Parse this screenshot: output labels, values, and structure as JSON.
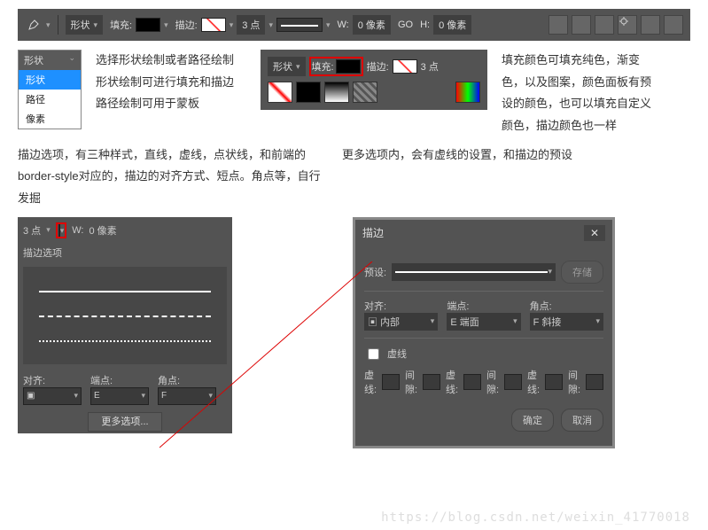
{
  "toolbar": {
    "shape_label": "形状",
    "fill_label": "填充:",
    "stroke_label": "描边:",
    "points": "3 点",
    "width_label": "W:",
    "width_val": "0 像素",
    "link_label": "GO",
    "height_label": "H:",
    "height_val": "0 像素"
  },
  "shape_dd": {
    "head": "形状",
    "items": [
      "形状",
      "路径",
      "像素"
    ]
  },
  "text": {
    "shape_desc_1": "选择形状绘制或者路径绘制",
    "shape_desc_2": "形状绘制可进行填充和描边",
    "shape_desc_3": "路径绘制可用于蒙板",
    "fill_desc": "填充颜色可填充纯色，渐变色，以及图案，颜色面板有预设的颜色，也可以填充自定义颜色，描边颜色也一样",
    "stroke_opts_desc": "描边选项，有三种样式，直线，虚线，点状线，和前端的border-style对应的，描边的对齐方式、短点。角点等，自行发掘",
    "more_opts_desc": "更多选项内，会有虚线的设置，和描边的预设"
  },
  "mini_toolbar": {
    "shape": "形状",
    "fill": "填充:",
    "stroke": "描边:",
    "pts": "3 点"
  },
  "stroke_panel": {
    "pts": "3 点",
    "w": "W:",
    "wval": "0 像素",
    "title": "描边选项",
    "align": "对齐:",
    "cap": "端点:",
    "corner": "角点:",
    "more": "更多选项..."
  },
  "dialog": {
    "title": "描边",
    "preset": "预设:",
    "save": "存储",
    "align": "对齐:",
    "align_val": "内部",
    "cap": "端点:",
    "cap_val": "端面",
    "corner": "角点:",
    "corner_val": "斜接",
    "dashed": "虚线",
    "dash_lbl": "虚线:",
    "gap_lbl": "间隙:",
    "ok": "确定",
    "cancel": "取消"
  },
  "watermark": "https://blog.csdn.net/weixin_41770018"
}
